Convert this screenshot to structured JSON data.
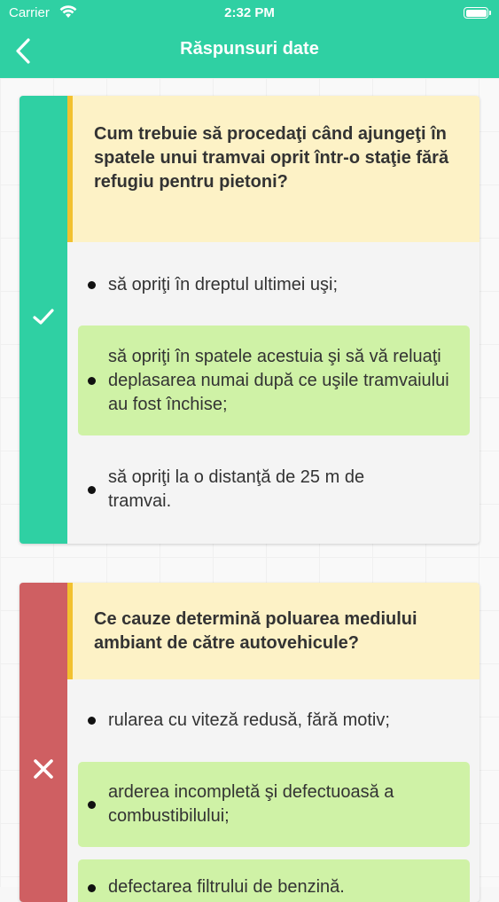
{
  "status_bar": {
    "carrier": "Carrier",
    "time": "2:32 PM",
    "wifi_icon": "wifi-icon",
    "battery_icon": "battery-icon"
  },
  "nav": {
    "title": "Răspunsuri date",
    "back_icon": "chevron-left-icon"
  },
  "colors": {
    "header": "#2fd0a3",
    "correct_strip": "#2fd0a3",
    "wrong_strip": "#cf5f62",
    "question_bg": "#fdf2c6",
    "question_accent": "#f2c12e",
    "correct_answer_bg": "#cff2a6"
  },
  "questions": [
    {
      "result": "correct",
      "result_icon": "checkmark-icon",
      "question": "Cum trebuie să procedaţi când ajungeţi în spatele unui tramvai oprit într-o staţie fără refugiu pentru pietoni?",
      "answers": [
        {
          "text": "să opriţi în dreptul ultimei uşi;",
          "correct": false
        },
        {
          "text": "să opriţi în spatele acestuia şi să vă reluaţi deplasarea numai după ce uşile tramvaiului au fost închise;",
          "correct": true
        },
        {
          "text": "să opriţi la o distanţă de 25 m de tramvai.",
          "correct": false
        }
      ]
    },
    {
      "result": "wrong",
      "result_icon": "close-icon",
      "question": "Ce cauze determină poluarea mediului ambiant de către autovehicule?",
      "answers": [
        {
          "text": "rularea cu viteză redusă, fără motiv;",
          "correct": false
        },
        {
          "text": "arderea incompletă şi defectuoasă a combustibilului;",
          "correct": true
        },
        {
          "text": "defectarea filtrului de benzină.",
          "correct": true
        }
      ]
    }
  ]
}
